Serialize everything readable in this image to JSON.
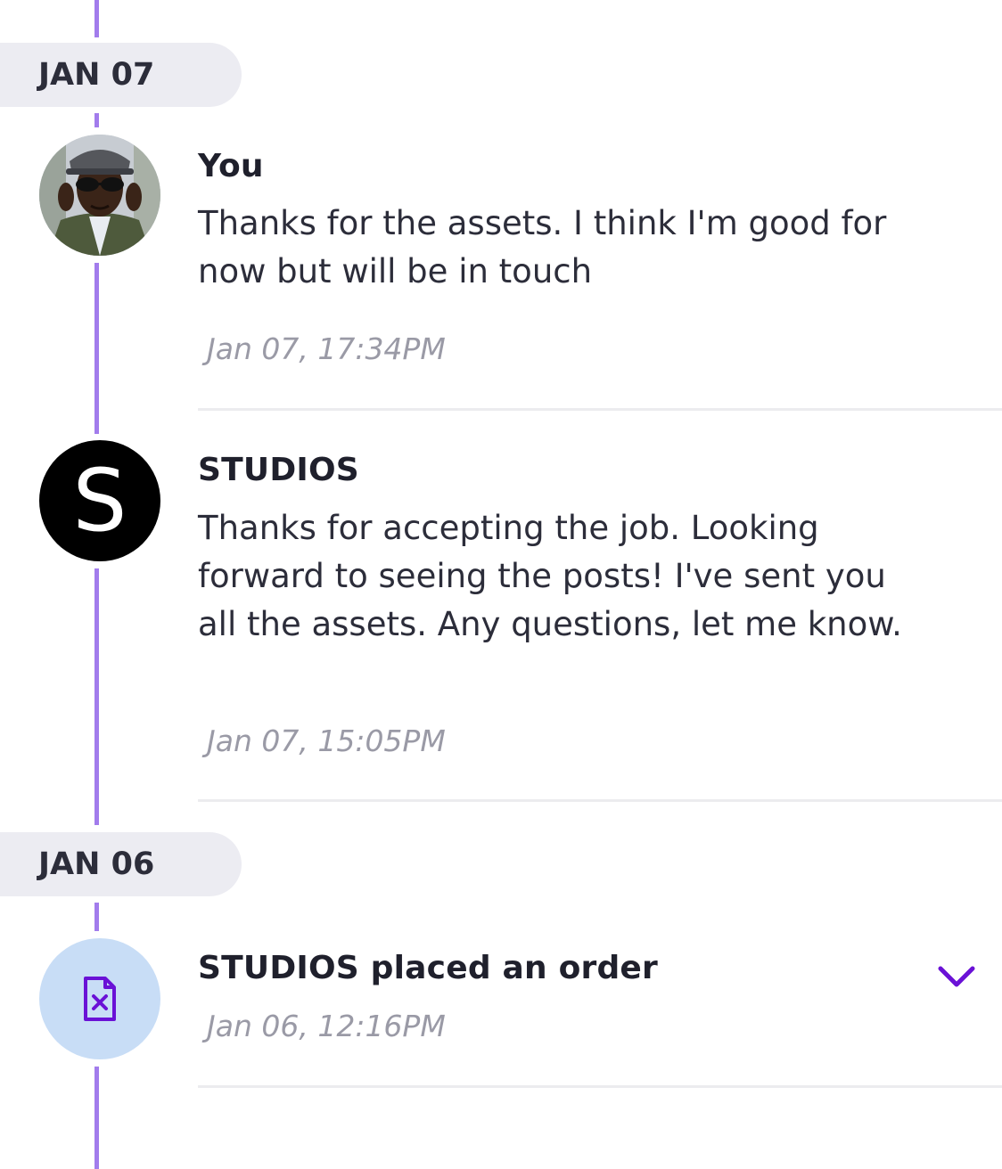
{
  "timeline": {
    "groups": [
      {
        "date_label": "JAN 07",
        "items": [
          {
            "author": "You",
            "message": "Thanks for the assets. I think I'm good for now but will be in touch",
            "timestamp": "Jan 07, 17:34PM",
            "avatar": "user-photo"
          },
          {
            "author": "STUDIOS",
            "avatar_letter": "S",
            "message": "Thanks for accepting the job. Looking forward to seeing the posts! I've sent you all the assets. Any questions, let me know.",
            "timestamp": "Jan 07, 15:05PM",
            "avatar": "letter-avatar"
          }
        ]
      },
      {
        "date_label": "JAN 06",
        "items": [
          {
            "event_text": "STUDIOS placed an order",
            "timestamp": "Jan 06, 12:16PM",
            "icon": "document-x-icon",
            "expand_icon": "chevron-down-icon"
          }
        ]
      }
    ]
  },
  "colors": {
    "timeline_line": "#a27cec",
    "date_pill_bg": "#ececf2",
    "order_icon_bg": "#c8ddf6",
    "accent_purple": "#6a11d6",
    "timestamp_gray": "#9a9aa6"
  }
}
